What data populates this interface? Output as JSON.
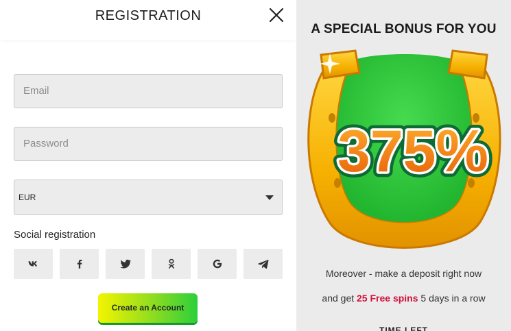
{
  "modal": {
    "title": "REGISTRATION",
    "close_icon": "close-icon"
  },
  "form": {
    "email_placeholder": "Email",
    "password_placeholder": "Password",
    "currency_value": "EUR",
    "social_label": "Social registration",
    "social_icons": [
      "vk-icon",
      "facebook-icon",
      "twitter-icon",
      "odnoklassniki-icon",
      "google-icon",
      "telegram-icon"
    ],
    "submit_label": "Create an Account"
  },
  "promo": {
    "title": "A SPECIAL BONUS FOR YOU",
    "percent": "375%",
    "line1": "Moreover - make a deposit right now",
    "line2_prefix": "and get ",
    "line2_highlight": "25 Free spins",
    "line2_suffix": " 5 days in a row",
    "timer_label": "TIME LEFT"
  },
  "colors": {
    "cta_start": "#f4f400",
    "cta_end": "#2bcf3a",
    "highlight": "#d0113d",
    "horseshoe": "#f7b800",
    "horseshoe_inner": "#2fc93f",
    "percent_fill": "#f47a10"
  }
}
